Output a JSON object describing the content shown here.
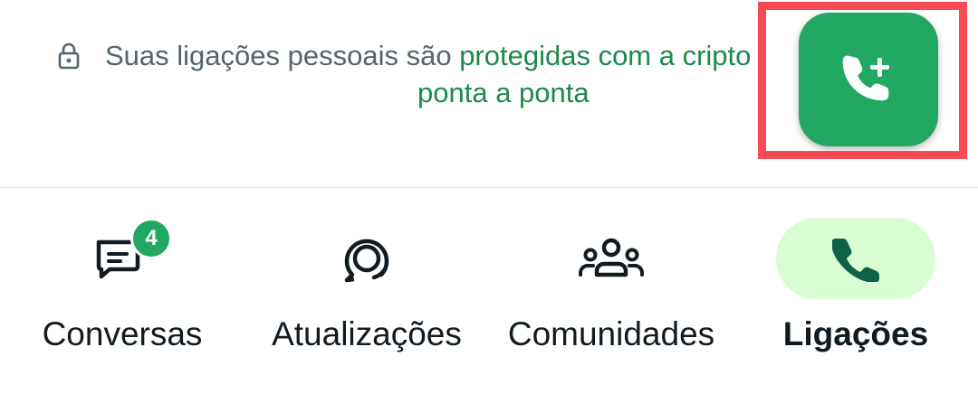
{
  "encryption_notice": {
    "text_prefix": "Suas ligações pessoais são ",
    "link_text_line1": "protegidas com a cripto",
    "link_text_line2": "ponta a ponta",
    "icon": "lock-icon"
  },
  "fab": {
    "icon": "add-call-icon",
    "color": "#21a863",
    "highlight_color": "#f54b55"
  },
  "bottom_nav": {
    "active_index": 3,
    "active_pill_color": "#d8fdd2",
    "items": [
      {
        "label": "Conversas",
        "icon": "chats-icon",
        "badge": "4"
      },
      {
        "label": "Atualizações",
        "icon": "updates-icon"
      },
      {
        "label": "Comunidades",
        "icon": "communities-icon"
      },
      {
        "label": "Ligações",
        "icon": "phone-icon"
      }
    ]
  }
}
